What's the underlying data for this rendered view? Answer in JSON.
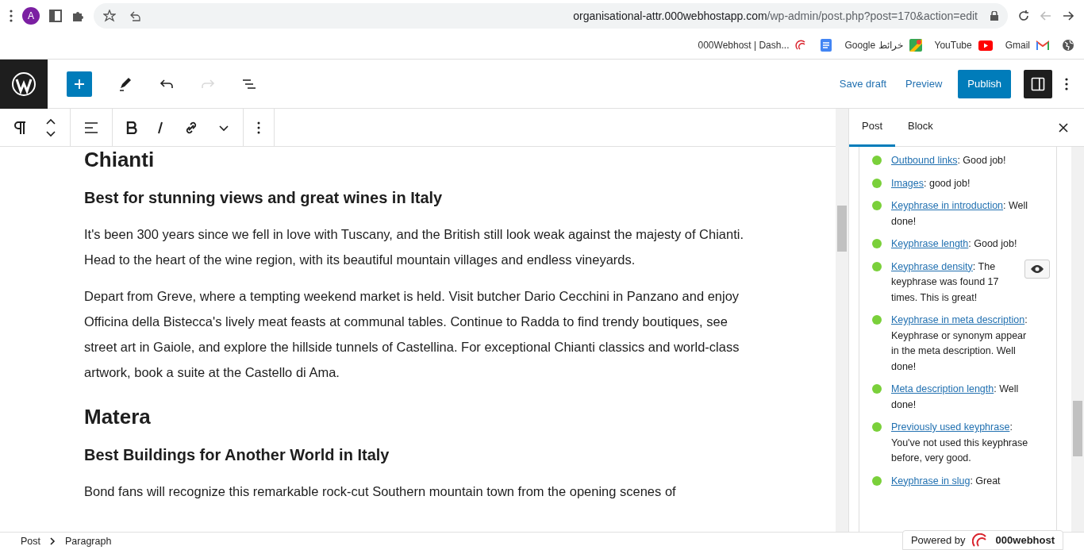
{
  "browser": {
    "url_host": "organisational-attr.000webhostapp.com",
    "url_path": "/wp-admin/post.php?post=170&action=edit",
    "profile_initial": "A",
    "bookmarks": [
      {
        "label": "000Webhost | Dash...",
        "kind": "webhost"
      },
      {
        "kind": "docs"
      },
      {
        "label": "Google خرائط",
        "kind": "maps"
      },
      {
        "label": "YouTube",
        "kind": "youtube"
      },
      {
        "label": "Gmail",
        "kind": "gmail"
      }
    ]
  },
  "header": {
    "tools": [
      {
        "kind": "add",
        "disabled": false
      },
      {
        "kind": "edit",
        "disabled": false
      },
      {
        "kind": "undo",
        "disabled": false
      },
      {
        "kind": "redo",
        "disabled": true
      },
      {
        "kind": "outline",
        "disabled": false
      }
    ],
    "save_draft": "Save draft",
    "preview": "Preview",
    "publish": "Publish",
    "settings_on": true
  },
  "content": [
    {
      "kind": "h2",
      "text": "Chianti"
    },
    {
      "kind": "h3",
      "text": "Best for stunning views and great wines in Italy"
    },
    {
      "kind": "p",
      "text": "It's been 300 years since we fell in love with Tuscany, and the British still look weak against the majesty of Chianti. Head to the heart of the wine region, with its beautiful mountain villages and endless vineyards."
    },
    {
      "kind": "p",
      "text": "Depart from Greve, where a tempting weekend market is held. Visit butcher Dario Cecchini in Panzano and enjoy Officina della Bistecca's lively meat feasts at communal tables. Continue to Radda to find trendy boutiques, see street art in Gaiole, and explore the hillside tunnels of Castellina. For exceptional Chianti classics and world-class artwork, book a suite at the Castello di Ama."
    },
    {
      "kind": "h2",
      "text": "Matera"
    },
    {
      "kind": "h3",
      "text": "Best Buildings for Another World in Italy"
    },
    {
      "kind": "p",
      "text": "Bond fans will recognize this remarkable rock-cut Southern mountain town from the opening scenes of"
    }
  ],
  "breadcrumb": [
    "Post",
    "Paragraph"
  ],
  "sidebar": {
    "tabs": [
      {
        "label": "Post",
        "selected": true
      },
      {
        "label": "Block",
        "selected": false
      }
    ],
    "checks": [
      {
        "link": "Outbound links",
        "text": ": Good job!",
        "color": "#7ad03a",
        "eye": false
      },
      {
        "link": "Images",
        "text": ": good job!",
        "color": "#7ad03a",
        "eye": false
      },
      {
        "link": "Keyphrase in introduction",
        "text": ": Well done!",
        "color": "#7ad03a",
        "eye": false
      },
      {
        "link": "Keyphrase length",
        "text": ": Good job!",
        "color": "#7ad03a",
        "eye": false
      },
      {
        "link": "Keyphrase density",
        "text": ": The keyphrase was found 17 times. This is great!",
        "color": "#7ad03a",
        "eye": true
      },
      {
        "link": "Keyphrase in meta description",
        "text": ": Keyphrase or synonym appear in the meta description. Well done!",
        "color": "#7ad03a",
        "eye": false
      },
      {
        "link": "Meta description length",
        "text": ": Well done!",
        "color": "#7ad03a",
        "eye": false
      },
      {
        "link": "Previously used keyphrase",
        "text": ": You've not used this keyphrase before, very good.",
        "color": "#7ad03a",
        "eye": false
      },
      {
        "link": "Keyphrase in slug",
        "text": ": Great",
        "color": "#7ad03a",
        "eye": false
      }
    ]
  },
  "powered_by": {
    "label": "Powered by",
    "brand": "000webhost"
  }
}
